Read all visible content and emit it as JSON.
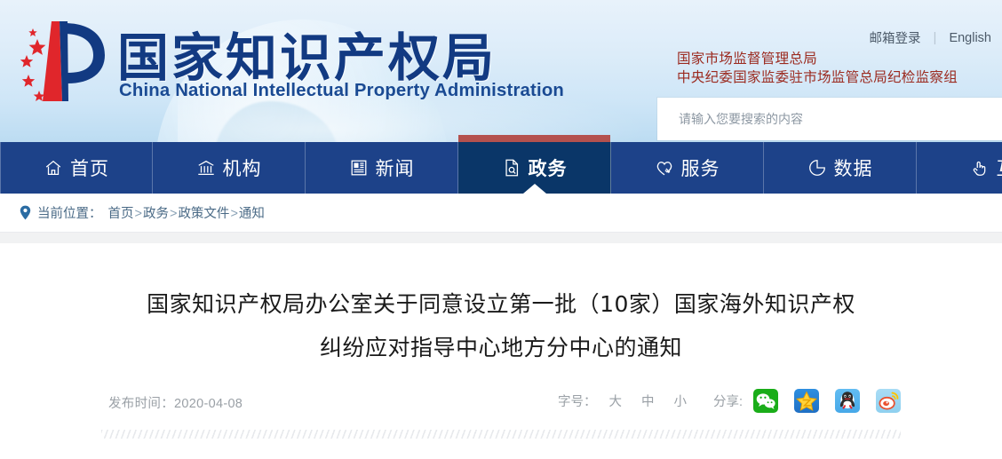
{
  "header": {
    "logo_cn": "国家知识产权局",
    "logo_en": "China National Intellectual Property Administration",
    "mail_login": "邮箱登录",
    "separator": "|",
    "english": "English",
    "org_line1": "国家市场监督管理总局",
    "org_line2": "中央纪委国家监委驻市场监管总局纪检监察组",
    "search_placeholder": "请输入您要搜索的内容",
    "search_value": "",
    "colors": {
      "org_red": "#9b2a1f",
      "logo_blue": "#123a82",
      "header_bg": "#dcecf9"
    }
  },
  "nav": {
    "active_index": 3,
    "accent_red": "#b4514e",
    "bg": "#1d4289",
    "active_bg": "#0a3668",
    "items": [
      {
        "label": "首页",
        "icon": "home-icon"
      },
      {
        "label": "机构",
        "icon": "bank-icon"
      },
      {
        "label": "新闻",
        "icon": "newspaper-icon"
      },
      {
        "label": "政务",
        "icon": "document-search-icon"
      },
      {
        "label": "服务",
        "icon": "service-heart-icon"
      },
      {
        "label": "数据",
        "icon": "pie-chart-icon"
      },
      {
        "label": "互",
        "icon": "hand-click-icon"
      }
    ]
  },
  "breadcrumb": {
    "icon": "location-pin-icon",
    "label": "当前位置：",
    "path": [
      "首页",
      "政务",
      "政策文件",
      "通知"
    ],
    "separator": ">"
  },
  "article": {
    "title_line1": "国家知识产权局办公室关于同意设立第一批（10家）国家海外知识产权",
    "title_line2": "纠纷应对指导中心地方分中心的通知",
    "publish_label": "发布时间：",
    "publish_date": "2020-04-08",
    "fontsize_label": "字号：",
    "fontsize_options": [
      "大",
      "中",
      "小"
    ],
    "share_label": "分享:",
    "share_items": [
      {
        "name": "wechat-share-icon",
        "title": "微信",
        "color": "#1aad19"
      },
      {
        "name": "qzone-share-icon",
        "title": "QQ空间",
        "color": "#2e8fe0"
      },
      {
        "name": "qq-share-icon",
        "title": "QQ",
        "color": "#46a8e8"
      },
      {
        "name": "weibo-share-icon",
        "title": "新浪微博",
        "color": "#8fd0ef"
      }
    ]
  }
}
